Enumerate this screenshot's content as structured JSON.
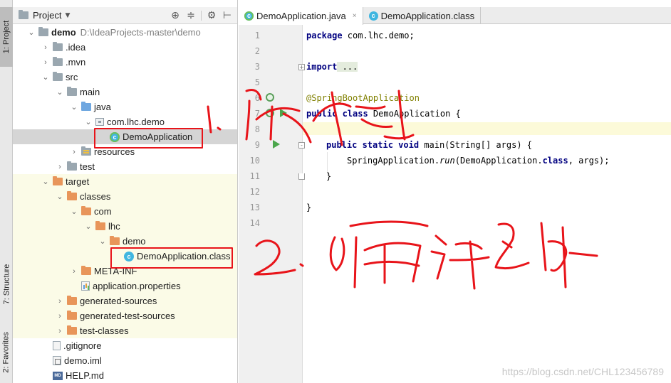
{
  "tool_strip": {
    "project_label": "1: Project",
    "structure_label": "7: Structure",
    "favorites_label": "2: Favorites"
  },
  "project_panel": {
    "title": "Project",
    "header_icons": [
      "target-icon",
      "collapse-icon",
      "gear-icon",
      "hide-icon"
    ],
    "tree": [
      {
        "label": "demo",
        "path": "D:\\IdeaProjects-master\\demo",
        "depth": 0,
        "arrow": "down",
        "icon": "folder",
        "bold": true
      },
      {
        "label": ".idea",
        "depth": 1,
        "arrow": "right",
        "icon": "folder"
      },
      {
        "label": ".mvn",
        "depth": 1,
        "arrow": "right",
        "icon": "folder"
      },
      {
        "label": "src",
        "depth": 1,
        "arrow": "down",
        "icon": "folder"
      },
      {
        "label": "main",
        "depth": 2,
        "arrow": "down",
        "icon": "folder"
      },
      {
        "label": "java",
        "depth": 3,
        "arrow": "down",
        "icon": "folder-blue"
      },
      {
        "label": "com.lhc.demo",
        "depth": 4,
        "arrow": "down",
        "icon": "package"
      },
      {
        "label": "DemoApplication",
        "depth": 5,
        "arrow": "none",
        "icon": "spring-class",
        "selected": true
      },
      {
        "label": "resources",
        "depth": 3,
        "arrow": "right",
        "icon": "folder-res"
      },
      {
        "label": "test",
        "depth": 2,
        "arrow": "right",
        "icon": "folder"
      },
      {
        "label": "target",
        "depth": 1,
        "arrow": "down",
        "icon": "folder-orange",
        "tint": true
      },
      {
        "label": "classes",
        "depth": 2,
        "arrow": "down",
        "icon": "folder-orange",
        "tint": true
      },
      {
        "label": "com",
        "depth": 3,
        "arrow": "down",
        "icon": "folder-orange",
        "tint": true
      },
      {
        "label": "lhc",
        "depth": 4,
        "arrow": "down",
        "icon": "folder-orange",
        "tint": true
      },
      {
        "label": "demo",
        "depth": 5,
        "arrow": "down",
        "icon": "folder-orange",
        "tint": true
      },
      {
        "label": "DemoApplication.class",
        "depth": 6,
        "arrow": "none",
        "icon": "class",
        "tint": true
      },
      {
        "label": "META-INF",
        "depth": 3,
        "arrow": "right",
        "icon": "folder-orange",
        "tint": true
      },
      {
        "label": "application.properties",
        "depth": 3,
        "arrow": "none",
        "icon": "properties",
        "tint": true
      },
      {
        "label": "generated-sources",
        "depth": 2,
        "arrow": "right",
        "icon": "folder-orange",
        "tint": true
      },
      {
        "label": "generated-test-sources",
        "depth": 2,
        "arrow": "right",
        "icon": "folder-orange",
        "tint": true
      },
      {
        "label": "test-classes",
        "depth": 2,
        "arrow": "right",
        "icon": "folder-orange",
        "tint": true
      },
      {
        "label": ".gitignore",
        "depth": 1,
        "arrow": "none",
        "icon": "file"
      },
      {
        "label": "demo.iml",
        "depth": 1,
        "arrow": "none",
        "icon": "iml"
      },
      {
        "label": "HELP.md",
        "depth": 1,
        "arrow": "none",
        "icon": "md"
      }
    ]
  },
  "editor": {
    "tabs": [
      {
        "label": "DemoApplication.java",
        "active": true,
        "close": "×"
      },
      {
        "label": "DemoApplication.class",
        "active": false
      }
    ],
    "line_numbers": [
      "1",
      "2",
      "3",
      "5",
      "6",
      "7",
      "8",
      "9",
      "10",
      "11",
      "12",
      "13",
      "14"
    ],
    "code": {
      "l1_kw": "package",
      "l1_rest": " com.lhc.demo;",
      "l3_kw": "import",
      "l3_rest": " ...",
      "l6_anno": "@SpringBootApplication",
      "l7_kw": "public class",
      "l7_rest": " DemoApplication {",
      "l9_kw": "public static void",
      "l9_rest": " main(String[] args) {",
      "l10_a": "SpringApplication.",
      "l10_b": "run",
      "l10_c": "(DemoApplication.",
      "l10_d": "class",
      "l10_e": ", args);",
      "l11": "}",
      "l13": "}"
    }
  },
  "watermark": "https://blog.csdn.net/CHL123456789",
  "annotation_color": "#e8141a"
}
